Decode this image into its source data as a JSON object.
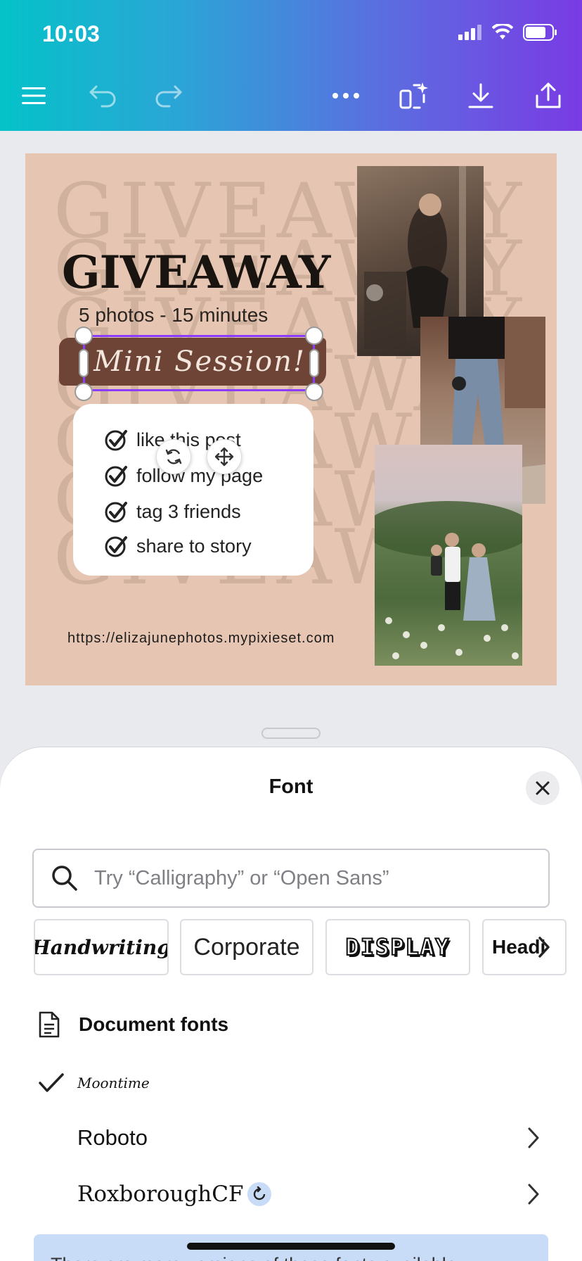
{
  "status": {
    "time": "10:03"
  },
  "toolbar": {
    "menu_icon": "hamburger-icon",
    "undo_icon": "undo-icon",
    "redo_icon": "redo-icon",
    "more_icon": "ellipsis-icon",
    "magic_icon": "magic-resize-icon",
    "download_icon": "download-icon",
    "share_icon": "share-icon"
  },
  "design": {
    "background_word": "GIVEAWAY",
    "headline": "GIVEAWAY",
    "subline": "5 photos - 15 minutes",
    "script_text": "Mini Session!",
    "checklist": [
      "like this post",
      "follow my page",
      "tag 3 friends",
      "share to story"
    ],
    "url": "https://elizajunephotos.mypixieset.com",
    "colors": {
      "canvas": "#e6c6b2",
      "brush": "#6e4436",
      "selection": "#8b3dff"
    }
  },
  "font_panel": {
    "title": "Font",
    "search_placeholder": "Try “Calligraphy” or “Open Sans”",
    "categories": [
      "Handwriting",
      "Corporate",
      "DISPLAY",
      "Headi"
    ],
    "section_title": "Document fonts",
    "fonts": [
      {
        "name": "Moontime",
        "selected": true
      },
      {
        "name": "Roboto",
        "selected": false
      },
      {
        "name": "RoxboroughCF",
        "selected": false
      }
    ],
    "banner_text": "There are more versions of these fonts available"
  }
}
